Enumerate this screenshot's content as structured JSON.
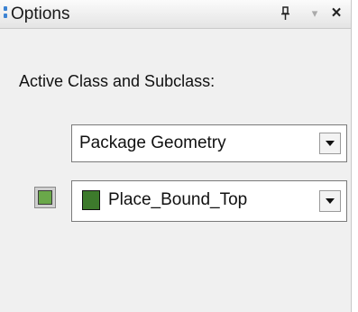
{
  "panel": {
    "title": "Options",
    "pin_icon": "pin-icon",
    "menu_icon": "dropdown-menu-icon",
    "close_icon": "close-icon"
  },
  "active_class": {
    "label": "Active Class and Subclass:",
    "class_value": "Package Geometry",
    "subclass_value": "Place_Bound_Top",
    "subclass_color": "#3d7a2c",
    "color_button_color": "#6aa84a"
  }
}
